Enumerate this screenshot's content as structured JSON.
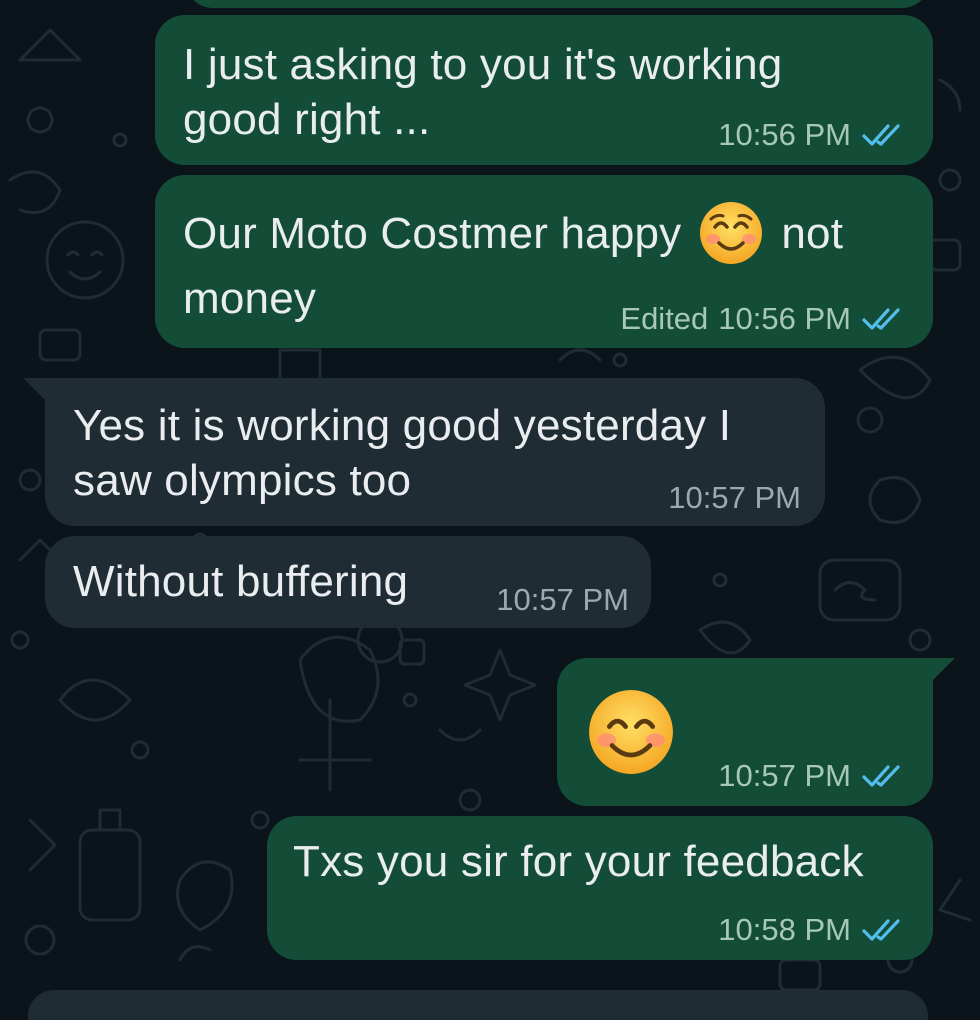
{
  "messages": [
    {
      "direction": "outgoing",
      "text_line1": "I just asking to you it's working",
      "text_line2": "good right ...",
      "time": "10:56 PM",
      "status": "read"
    },
    {
      "direction": "outgoing",
      "text_line1_a": "Our Moto Costmer happy",
      "emoji": "smiling-face-with-smiling-eyes",
      "text_line1_b": "not",
      "text_line2": "money",
      "edited_label": "Edited",
      "time": "10:56 PM",
      "status": "read"
    },
    {
      "direction": "incoming",
      "text_line1": "Yes it is working good yesterday I",
      "text_line2": "saw olympics too",
      "time": "10:57 PM"
    },
    {
      "direction": "incoming",
      "text_line1": "Without buffering",
      "time": "10:57 PM"
    },
    {
      "direction": "outgoing",
      "emoji": "smiling-face-with-smiling-eyes",
      "time": "10:57 PM",
      "status": "read"
    },
    {
      "direction": "outgoing",
      "text_line1": "Txs you sir for your feedback",
      "time": "10:58 PM",
      "status": "read"
    }
  ],
  "colors": {
    "background": "#0b141a",
    "outgoing_bubble": "#134d37",
    "incoming_bubble": "#202c33",
    "text": "#e9edef",
    "read_tick": "#53bdeb"
  }
}
